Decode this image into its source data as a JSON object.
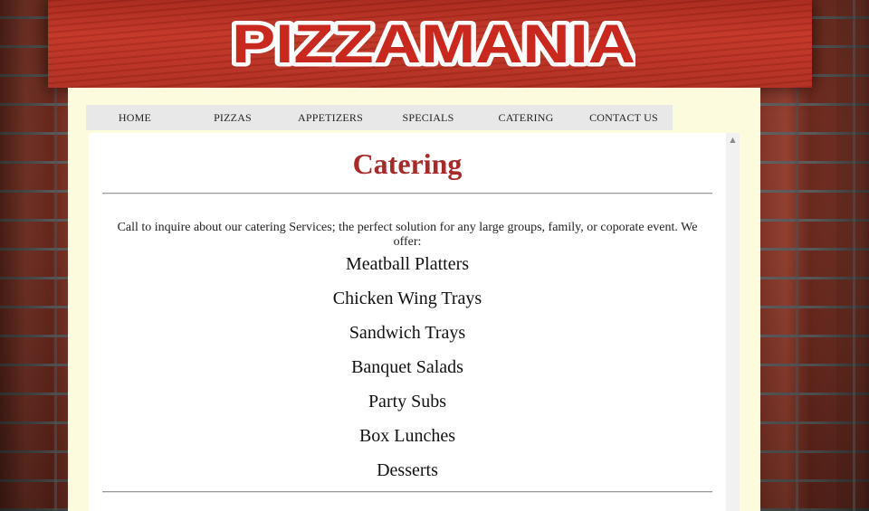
{
  "brand": {
    "logo_text": "PIZZAMANIA"
  },
  "nav": {
    "items": [
      {
        "label": "HOME"
      },
      {
        "label": "PIZZAS"
      },
      {
        "label": "APPETIZERS"
      },
      {
        "label": "SPECIALS"
      },
      {
        "label": "CATERING"
      },
      {
        "label": "CONTACT US"
      }
    ]
  },
  "page": {
    "title": "Catering",
    "intro": "Call to inquire about our catering Services; the perfect solution for any large groups, family, or coporate event. We offer:",
    "offers": [
      "Meatball Platters",
      "Chicken Wing Trays",
      "Sandwich Trays",
      "Banquet Salads",
      "Party Subs",
      "Box Lunches",
      "Desserts"
    ]
  },
  "scrollbar": {
    "up_arrow_icon": "scroll-up-arrow-icon"
  },
  "colors": {
    "title": "#a52a2a",
    "logo_fill": "#c8281e",
    "logo_stroke": "#ffffff",
    "content_background": "#fdfbdd",
    "nav_background": "#e8e8e8",
    "header_wood": "#b02c1f"
  }
}
